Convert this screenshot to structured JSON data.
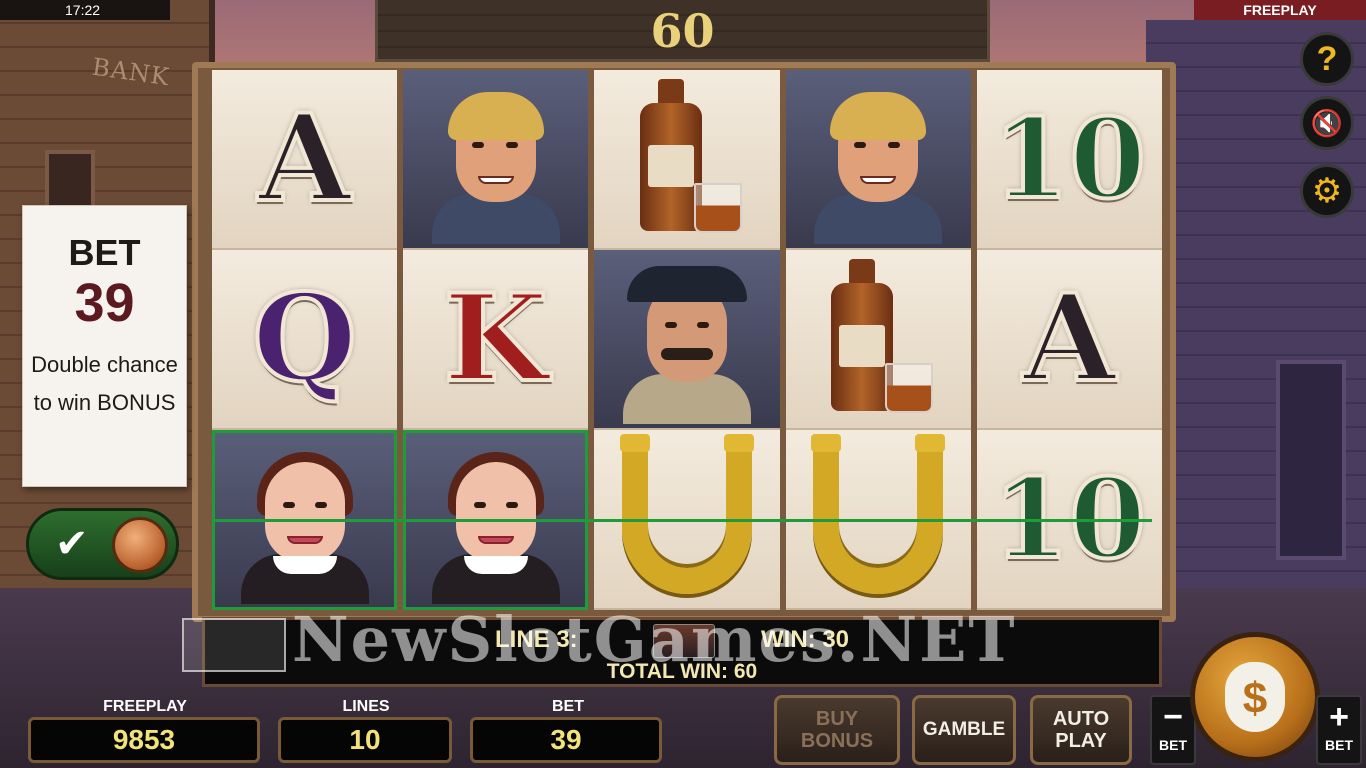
{
  "status": {
    "clock": "17:22",
    "mode": "FREEPLAY"
  },
  "top_win": "60",
  "scenery": {
    "bank_sign": "BANK"
  },
  "bet_card": {
    "title": "BET",
    "amount": "39",
    "text": "Double chance to win BONUS"
  },
  "bonus_toggle": {
    "on": true
  },
  "side_buttons": [
    "help-icon",
    "sound-muted-icon",
    "gear-icon"
  ],
  "reels": [
    [
      "A",
      "Q",
      "lady"
    ],
    [
      "outlaw",
      "K",
      "lady"
    ],
    [
      "whiskey",
      "sheriff",
      "horseshoe"
    ],
    [
      "outlaw",
      "whiskey",
      "horseshoe"
    ],
    [
      "10",
      "A",
      "10"
    ]
  ],
  "win_info": {
    "line_label": "LINE 3:",
    "win_label": "WIN: 30",
    "total_label": "TOTAL WIN: 60"
  },
  "watermark": "NewSlotGames.NET",
  "meters": {
    "freeplay": {
      "label": "FREEPLAY",
      "value": "9853"
    },
    "lines": {
      "label": "LINES",
      "value": "10"
    },
    "bet": {
      "label": "BET",
      "value": "39"
    }
  },
  "buttons": {
    "buy_bonus": [
      "BUY",
      "BONUS"
    ],
    "gamble": "GAMBLE",
    "auto_play": [
      "AUTO",
      "PLAY"
    ],
    "bet_minus": {
      "sign": "−",
      "label": "BET"
    },
    "bet_plus": {
      "sign": "+",
      "label": "BET"
    }
  },
  "colors": {
    "win_line": "#1f9c3a",
    "accent_gold": "#f0b820"
  }
}
